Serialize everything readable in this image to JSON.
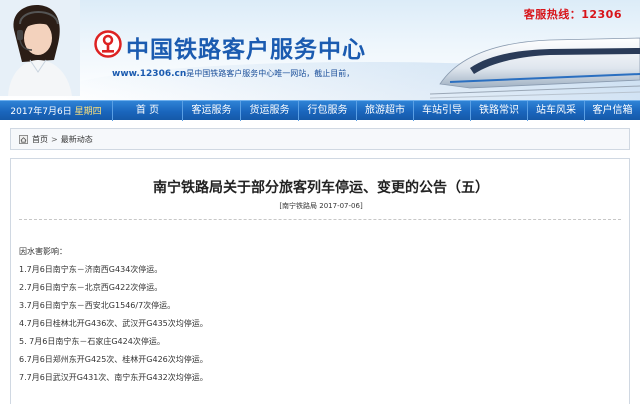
{
  "header": {
    "hotline": "客服热线：12306",
    "site_title": "中国铁路客户服务中心",
    "site_url": "www.12306.cn",
    "site_slogan": "是中国铁路客户服务中心唯一网站，截止目前，",
    "brand_color": "#1b5bb0",
    "hotline_color": "#d8141a"
  },
  "nav": {
    "date": "2017年7月6日",
    "weekday": "星期四",
    "items": [
      {
        "label": "首  页"
      },
      {
        "label": "客运服务"
      },
      {
        "label": "货运服务"
      },
      {
        "label": "行包服务"
      },
      {
        "label": "旅游超市"
      },
      {
        "label": "车站引导"
      },
      {
        "label": "铁路常识"
      },
      {
        "label": "站车风采"
      },
      {
        "label": "客户信箱"
      }
    ]
  },
  "breadcrumb": {
    "home": "首页",
    "separator": ">",
    "current": "最新动态"
  },
  "article": {
    "title": "南宁铁路局关于部分旅客列车停运、变更的公告（五）",
    "meta": "[南宁铁路局   2017-07-06]",
    "lines": [
      "因水害影响：",
      "1.7月6日南宁东－济南西G434次停运。",
      "2.7月6日南宁东－北京西G422次停运。",
      "3.7月6日南宁东－西安北G1546/7次停运。",
      "4.7月6日桂林北开G436次、武汉开G435次均停运。",
      "5.  7月6日南宁东－石家庄G424次停运。",
      "6.7月6日郑州东开G425次、桂林开G426次均停运。",
      "7.7月6日武汉开G431次、南宁东开G432次均停运。"
    ]
  }
}
